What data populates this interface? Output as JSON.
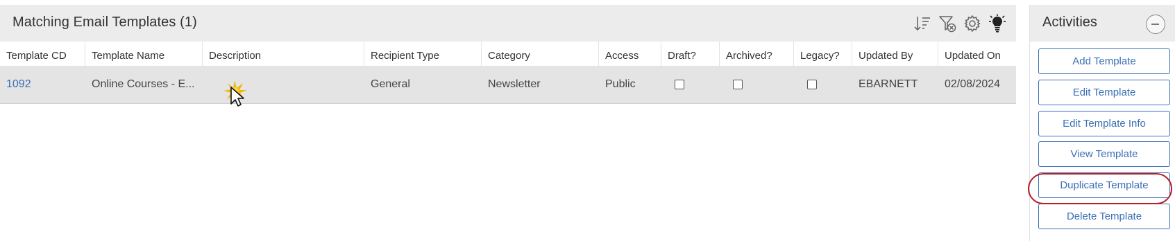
{
  "grid": {
    "title": "Matching Email Templates (1)",
    "toolbar": {
      "sort_icon": "sort-descending-icon",
      "filter_icon": "clear-filter-icon",
      "settings_icon": "gear-icon",
      "tips_icon": "lightbulb-icon"
    },
    "columns": [
      "Template CD",
      "Template Name",
      "Description",
      "Recipient Type",
      "Category",
      "Access",
      "Draft?",
      "Archived?",
      "Legacy?",
      "Updated By",
      "Updated On"
    ],
    "rows": [
      {
        "template_cd": "1092",
        "template_name": "Online Courses - E...",
        "description": "",
        "recipient_type": "General",
        "category": "Newsletter",
        "access": "Public",
        "draft": false,
        "archived": false,
        "legacy": false,
        "updated_by": "EBARNETT",
        "updated_on": "02/08/2024"
      }
    ]
  },
  "activities": {
    "title": "Activities",
    "collapse_icon": "minus-circle-icon",
    "buttons": [
      "Add Template",
      "Edit Template",
      "Edit Template Info",
      "View Template",
      "Duplicate Template",
      "Delete Template"
    ],
    "highlighted": "Duplicate Template"
  },
  "colors": {
    "header_bg": "#ececec",
    "row_selected_bg": "#e4e4e4",
    "link": "#3a6fb5",
    "highlight_ring": "#b3202a"
  }
}
